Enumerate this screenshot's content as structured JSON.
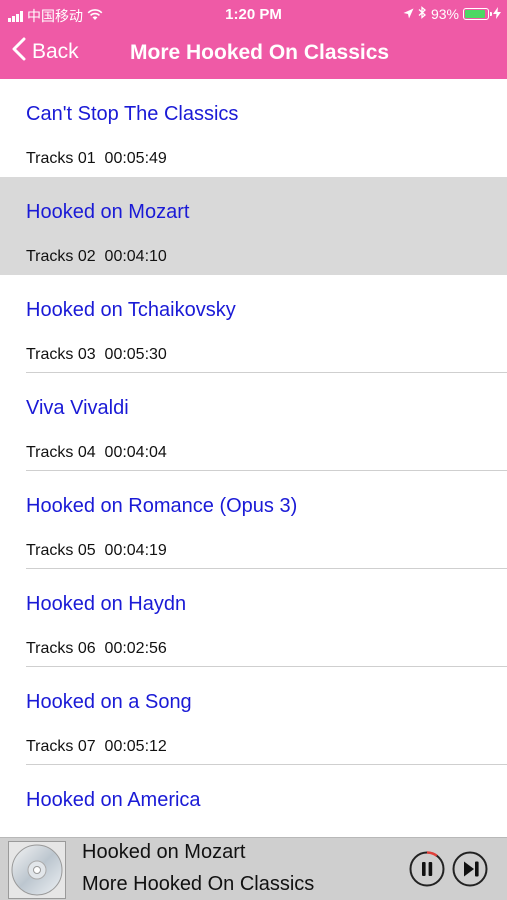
{
  "status_bar": {
    "carrier": "中国移动",
    "time": "1:20 PM",
    "battery_percent": "93%",
    "battery_level": 0.93,
    "icons": [
      "signal-icon",
      "wifi-icon",
      "location-icon",
      "bluetooth-icon",
      "battery-icon",
      "charging-icon"
    ]
  },
  "nav": {
    "back_label": "Back",
    "title": "More Hooked On Classics"
  },
  "tracks": [
    {
      "title": "Can't Stop The Classics",
      "meta": "Tracks 01  00:05:49"
    },
    {
      "title": "Hooked on Mozart",
      "meta": "Tracks 02  00:04:10"
    },
    {
      "title": "Hooked on Tchaikovsky",
      "meta": "Tracks 03  00:05:30"
    },
    {
      "title": "Viva Vivaldi",
      "meta": "Tracks 04  00:04:04"
    },
    {
      "title": "Hooked on Romance (Opus 3)",
      "meta": "Tracks 05  00:04:19"
    },
    {
      "title": "Hooked on Haydn",
      "meta": "Tracks 06  00:02:56"
    },
    {
      "title": "Hooked on a Song",
      "meta": "Tracks 07  00:05:12"
    },
    {
      "title": "Hooked on America",
      "meta": ""
    }
  ],
  "selected_index": 1,
  "now_playing": {
    "title": "Hooked on Mozart",
    "album": "More Hooked On Classics",
    "progress": 0.1,
    "controls": [
      "pause-icon",
      "next-track-icon"
    ]
  },
  "colors": {
    "accent": "#ef5aa6",
    "track_title": "#1a1ad6",
    "selected_row": "#d9d9d9",
    "player_bg": "#cfcfcf",
    "progress": "#e0403a"
  }
}
